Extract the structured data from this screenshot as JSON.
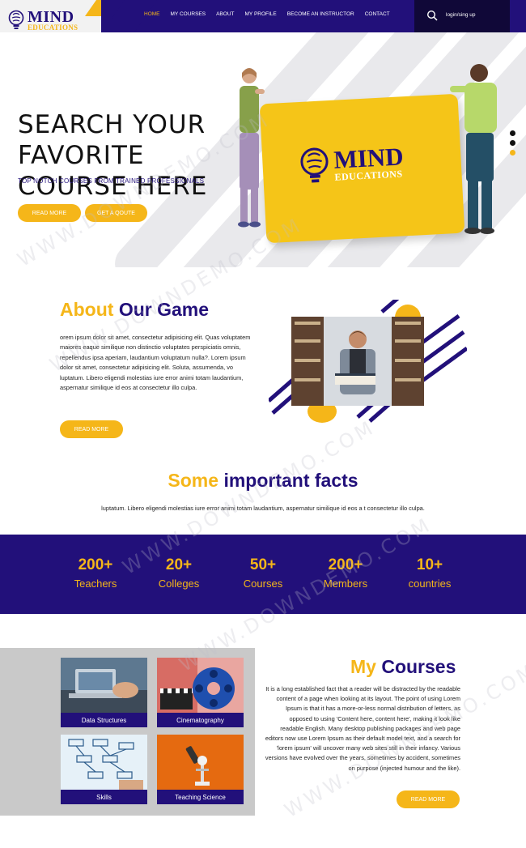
{
  "header": {
    "logo_main": "MIND",
    "logo_sub": "EDUCATIONS",
    "nav": [
      {
        "label": "HOME",
        "active": true
      },
      {
        "label": "MY COURSES",
        "active": false
      },
      {
        "label": "ABOUT",
        "active": false
      },
      {
        "label": "MY PROFILE",
        "active": false
      },
      {
        "label": "BECOME AN INSTRUCTOR",
        "active": false
      },
      {
        "label": "CONTACT",
        "active": false
      }
    ],
    "login": "login/sing up",
    "search_icon": "search-icon"
  },
  "hero": {
    "title_lines": [
      "SEARCH YOUR",
      "FAVORITE",
      "COURSE HERE"
    ],
    "subtitle": "TOP NOTCH COURSES FROM TRAINED PROFESSIONALS",
    "read_more": "READ MORE",
    "get_quote": "GET A QOUTE",
    "board_logo_main": "MIND",
    "board_logo_sub": "EDUCATIONS"
  },
  "about": {
    "title_accent": "About",
    "title_rest": "Our Game",
    "text": "orem ipsum dolor sit amet, consectetur adipisicing elit. Quas voluptatem maiores eaque similique non distinctio voluptates perspiciatis omnis, repellendus ipsa aperiam, laudantium voluptatum nulla?. Lorem ipsum dolor sit amet, consectetur adipisicing elit. Soluta, assumenda, vo luptatum. Libero eligendi molestias iure error animi totam laudantium, aspernatur similique id eos at consectetur illo culpa.",
    "read_more": "READ MORE"
  },
  "facts": {
    "title_accent": "Some",
    "title_rest": "important facts",
    "subtitle": "luptatum. Libero eligendi molestias iure error animi totam laudantium, aspernatur similique id eos a t consectetur illo culpa.",
    "stats": [
      {
        "value": "200+",
        "label": "Teachers"
      },
      {
        "value": "20+",
        "label": "Colleges"
      },
      {
        "value": "50+",
        "label": "Courses"
      },
      {
        "value": "200+",
        "label": "Members"
      },
      {
        "value": "10+",
        "label": "countries"
      }
    ]
  },
  "courses": {
    "title_accent": "My",
    "title_rest": "Courses",
    "cards": [
      {
        "label": "Data Structures"
      },
      {
        "label": "Cinematography"
      },
      {
        "label": "Skills"
      },
      {
        "label": "Teaching Science"
      }
    ],
    "text": "It is a long established fact that a reader will be distracted by the readable content of a page when looking at its layout. The point of using Lorem Ipsum is that it has a more-or-less normal distribution of letters, as opposed to using 'Content here, content here', making it look like readable English. Many desktop publishing packages and web page editors now use Lorem Ipsum as their default model text, and a search for 'lorem ipsum' will uncover many web sites still in their infancy. Various versions have evolved over the years, sometimes by accident, sometimes on purpose (injected humour and the like).",
    "read_more": "READ MORE"
  },
  "watermark": "WWW.DOWNDEMO.COM",
  "colors": {
    "primary": "#22107a",
    "accent": "#f5b619",
    "light": "#f2f2f2"
  }
}
